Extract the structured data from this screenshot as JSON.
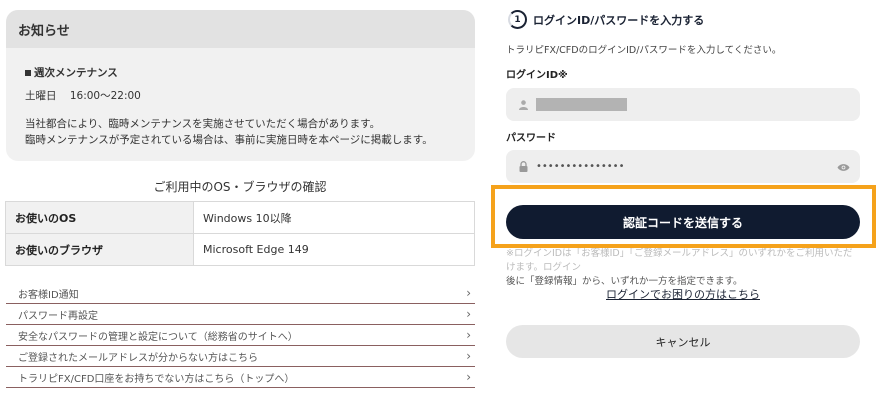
{
  "notice": {
    "title": "お知らせ",
    "subtitle": "週次メンテナンス",
    "day": "土曜日",
    "time": "16:00〜22:00",
    "line1": "当社都合により、臨時メンテナンスを実施させていただく場合があります。",
    "line2": "臨時メンテナンスが予定されている場合は、事前に実施日時を本ページに掲載します。"
  },
  "env": {
    "title": "ご利用中のOS・ブラウザの確認",
    "rows": [
      {
        "key": "お使いのOS",
        "value": "Windows 10以降"
      },
      {
        "key": "お使いのブラウザ",
        "value": "Microsoft Edge 149"
      }
    ]
  },
  "links": [
    "お客様ID通知",
    "パスワード再設定",
    "安全なパスワードの管理と設定について（総務省のサイトへ）",
    "ご登録されたメールアドレスが分からない方はこちら",
    "トラリピFX/CFD口座をお持ちでない方はこちら（トップへ）"
  ],
  "login": {
    "step_number": "1",
    "step_title": "ログインID/パスワードを入力する",
    "description": "トラリピFX/CFDのログインID/パスワードを入力してください。",
    "id_label": "ログインID※",
    "password_label": "パスワード",
    "password_value": "•••••••••••••••",
    "send_button": "認証コードを送信する",
    "note_faded": "※ログインIDは「お客様ID」「ご登録メールアドレス」のいずれかをご利用いただけます。ログイン",
    "note_line2": "後に「登録情報」から、いずれか一方を指定できます。",
    "help_link": "ログインでお困りの方はこちら",
    "cancel_button": "キャンセル"
  },
  "colors": {
    "primary": "#101b30",
    "highlight": "#f5a21b",
    "field_bg": "#eeeeee"
  }
}
